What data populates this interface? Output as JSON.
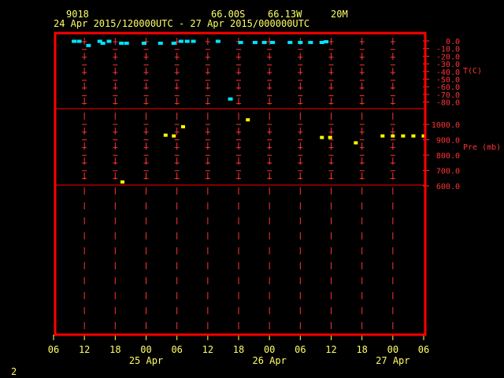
{
  "header": {
    "station_id": "9018",
    "latitude": "66.00S",
    "longitude": "66.13W",
    "elevation": "20M",
    "time_range": "24 Apr 2015/120000UTC - 27 Apr 2015/000000UTC"
  },
  "page_number": "2",
  "colors": {
    "frame": "#ff0000",
    "grid": "#ff3333",
    "labels": "#ffff66",
    "temperature": "#00e5ff",
    "pressure": "#ffff00"
  },
  "chart_data": [
    {
      "type": "scatter",
      "series": [
        {
          "name": "T(C)",
          "x": [
            2.0,
            2.5,
            3.4,
            4.5,
            4.8,
            5.4,
            6.6,
            7.1,
            8.8,
            10.4,
            11.7,
            12.4,
            13.0,
            13.6,
            16.0,
            17.2,
            18.2,
            19.6,
            20.5,
            21.3,
            23.0,
            24.0,
            25.0,
            26.1,
            26.5
          ],
          "y": [
            -0.5,
            -0.5,
            -6.0,
            -0.5,
            -3.0,
            -0.5,
            -3.0,
            -3.0,
            -3.0,
            -3.0,
            -3.0,
            -0.5,
            -0.5,
            -0.5,
            -0.5,
            -76.0,
            -2.0,
            -2.0,
            -2.0,
            -2.0,
            -2.0,
            -2.0,
            -2.0,
            -2.0,
            -1.0
          ]
        }
      ],
      "ylabel": "T(C)",
      "yticks": [
        "0.0",
        "-10.0",
        "-20.0",
        "-30.0",
        "-40.0",
        "-50.0",
        "-60.0",
        "-70.0",
        "-80.0"
      ],
      "ylim": [
        -82,
        5
      ],
      "xlim": [
        0,
        48
      ]
    },
    {
      "type": "scatter",
      "series": [
        {
          "name": "Pre (mb)",
          "x": [
            6.7,
            10.9,
            11.7,
            12.6,
            18.9,
            26.1,
            26.9,
            29.4,
            32.0,
            33.0,
            34.0,
            35.0,
            36.0
          ],
          "y": [
            625,
            930,
            925,
            985,
            1030,
            915,
            915,
            880,
            925,
            925,
            925,
            925,
            925
          ]
        }
      ],
      "ylabel": "Pre (mb)",
      "yticks": [
        "1000.0",
        "900.0",
        "800.0",
        "700.0",
        "600.0"
      ],
      "ylim": [
        600,
        1100
      ],
      "xlim": [
        0,
        48
      ]
    },
    {
      "type": "scatter",
      "series": [],
      "xlim": [
        0,
        48
      ]
    }
  ],
  "x_axis": {
    "tick_labels": [
      "06",
      "12",
      "18",
      "00",
      "06",
      "12",
      "18",
      "00",
      "06",
      "12",
      "18",
      "00",
      "06"
    ],
    "day_labels": [
      {
        "text": "25 Apr",
        "hour": 18
      },
      {
        "text": "26 Apr",
        "hour": 42
      },
      {
        "text": "27 Apr",
        "hour": 66
      }
    ]
  }
}
